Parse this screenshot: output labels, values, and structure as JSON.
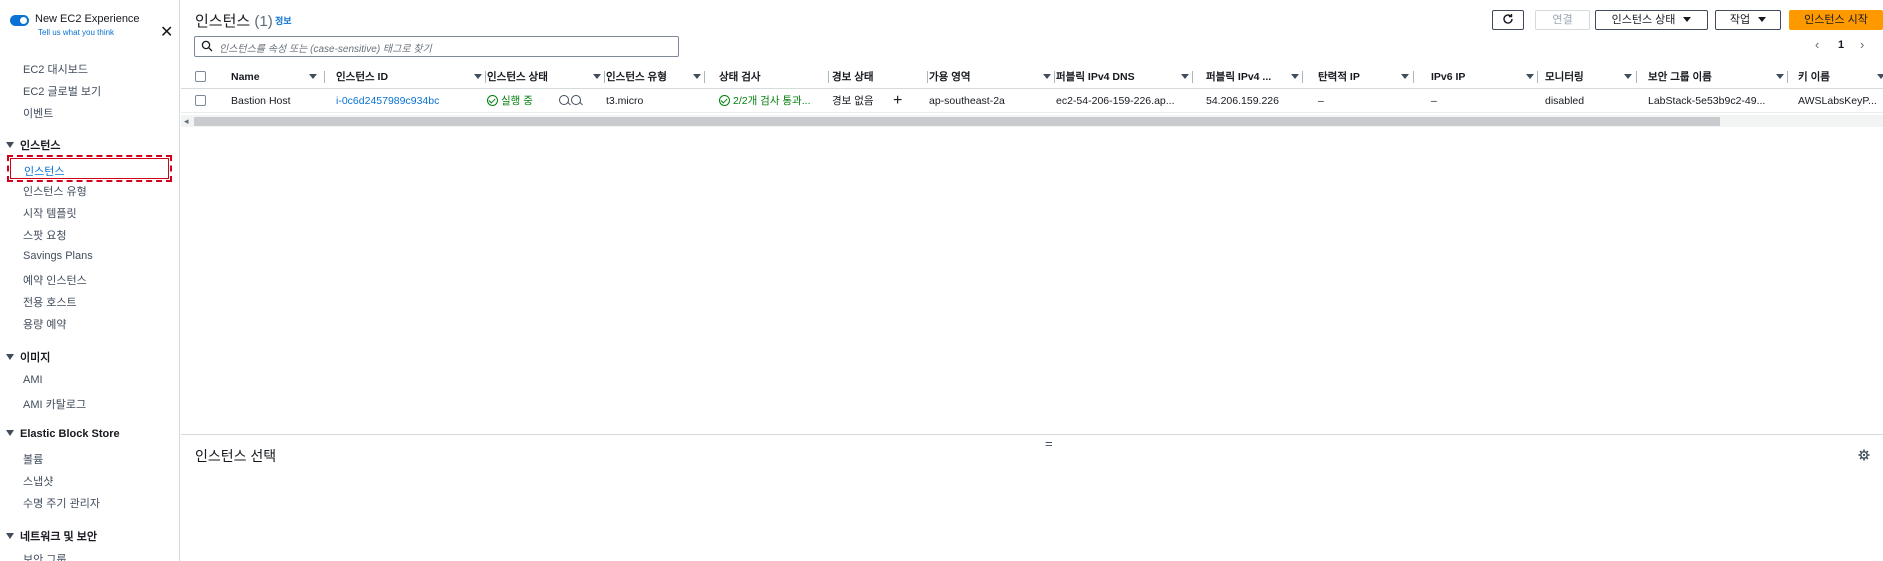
{
  "sidebar": {
    "toggle_title": "New EC2 Experience",
    "toggle_subtitle": "Tell us what you think",
    "close_label": "✕",
    "links_top": [
      "EC2 대시보드",
      "EC2 글로벌 보기",
      "이벤트"
    ],
    "section_instances": "인스턴스",
    "instances_items": [
      "인스턴스",
      "인스턴스 유형",
      "시작 템플릿",
      "스팟 요청",
      "Savings Plans",
      "예약 인스턴스",
      "전용 호스트",
      "용량 예약"
    ],
    "section_images": "이미지",
    "images_items": [
      "AMI",
      "AMI 카탈로그"
    ],
    "section_ebs": "Elastic Block Store",
    "ebs_items": [
      "볼륨",
      "스냅샷",
      "수명 주기 관리자"
    ],
    "section_network": "네트워크 및 보안",
    "network_items": [
      "보안 그룹"
    ]
  },
  "header": {
    "title": "인스턴스",
    "count": "(1)",
    "info": "정보",
    "connect": "연결",
    "instance_state": "인스턴스 상태",
    "actions": "작업",
    "launch": "인스턴스 시작"
  },
  "search": {
    "placeholder": "인스턴스를 속성 또는 (case-sensitive) 태그로 찾기"
  },
  "pagination": {
    "prev": "‹",
    "page": "1",
    "next": "›"
  },
  "table": {
    "columns": [
      "Name",
      "인스턴스 ID",
      "인스턴스 상태",
      "인스턴스 유형",
      "상태 검사",
      "경보 상태",
      "가용 영역",
      "퍼블릭 IPv4 DNS",
      "퍼블릭 IPv4 ...",
      "탄력적 IP",
      "IPv6 IP",
      "모니터링",
      "보안 그룹 이름",
      "키 이름"
    ],
    "rows": [
      {
        "name": "Bastion Host",
        "instance_id": "i-0c6d2457989c934bc",
        "state": "실행 중",
        "type": "t3.micro",
        "status_check": "2/2개 검사 통과...",
        "alarm": "경보 없음",
        "az": "ap-southeast-2a",
        "public_dns": "ec2-54-206-159-226.ap...",
        "public_ip": "54.206.159.226",
        "elastic_ip": "–",
        "ipv6": "–",
        "monitoring": "disabled",
        "security_group": "LabStack-5e53b9c2-49...",
        "key_name": "AWSLabsKeyP..."
      }
    ]
  },
  "split_panel": {
    "title": "인스턴스 선택",
    "handle": "="
  },
  "colors": {
    "accent": "#0972d3",
    "primary_button": "#ff9900",
    "success": "#037f0c",
    "highlight": "#d0021b"
  }
}
